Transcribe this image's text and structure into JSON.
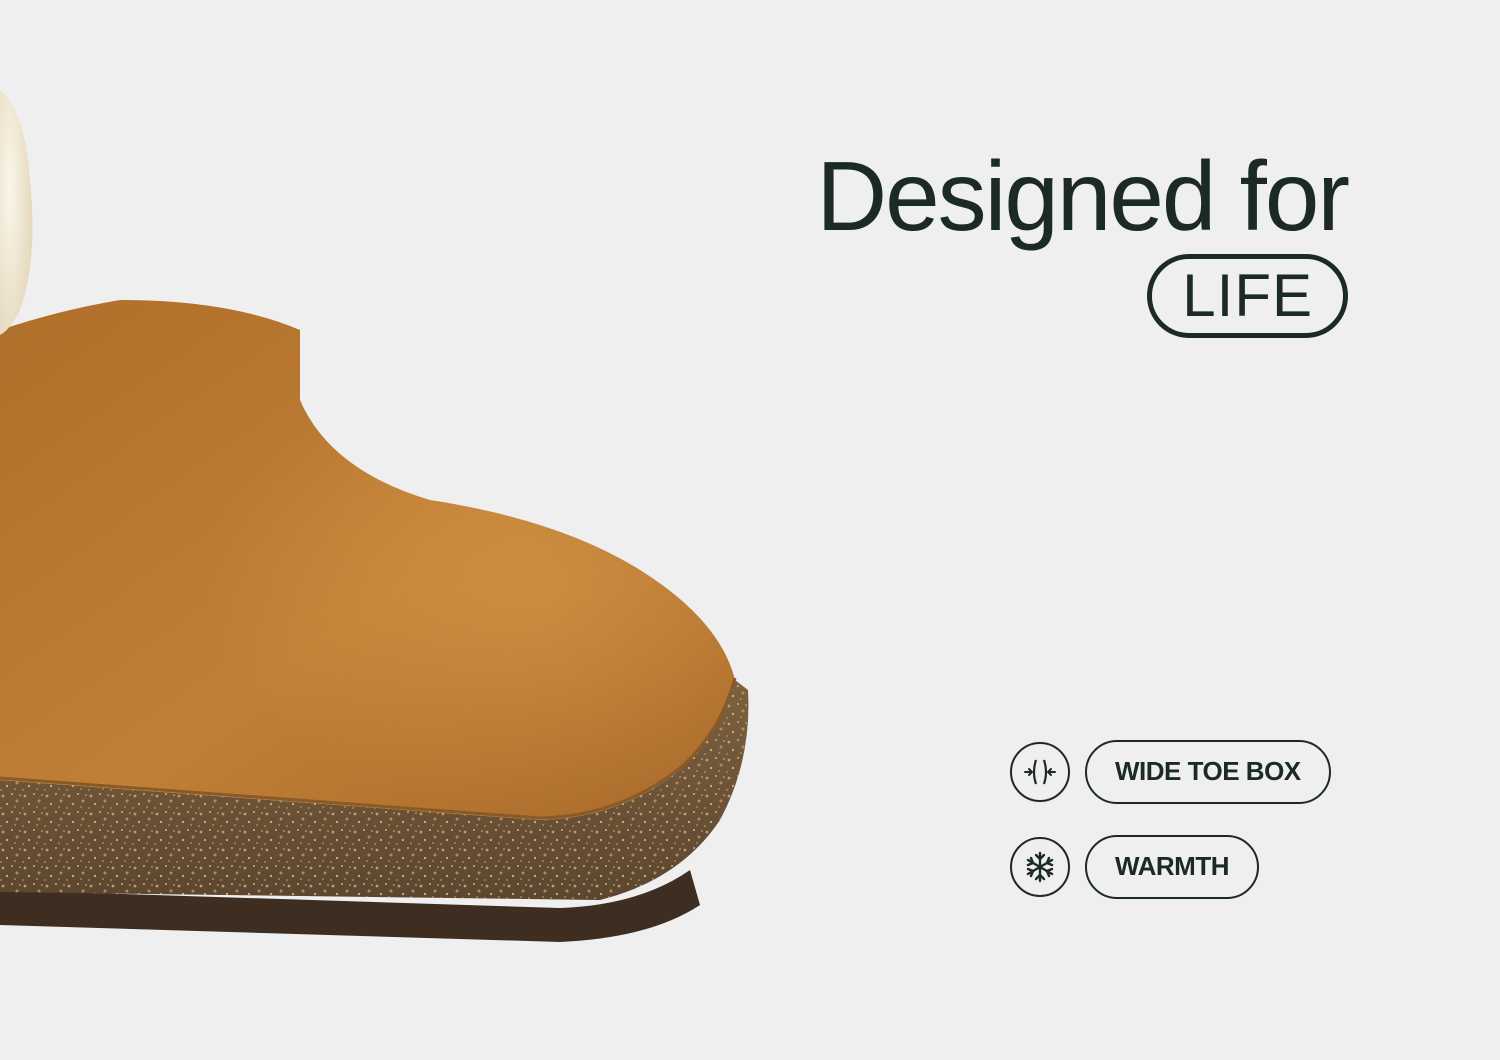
{
  "headline": {
    "main": "Designed for",
    "pill": "LIFE"
  },
  "features": [
    {
      "icon": "wide-toe-box-icon",
      "label": "WIDE TOE BOX"
    },
    {
      "icon": "snowflake-icon",
      "label": "WARMTH"
    }
  ],
  "colors": {
    "background": "#efefef",
    "ink": "#1b2a26",
    "suede": "#b87830",
    "cork": "#6d5538",
    "fur": "#f1e8d4"
  }
}
